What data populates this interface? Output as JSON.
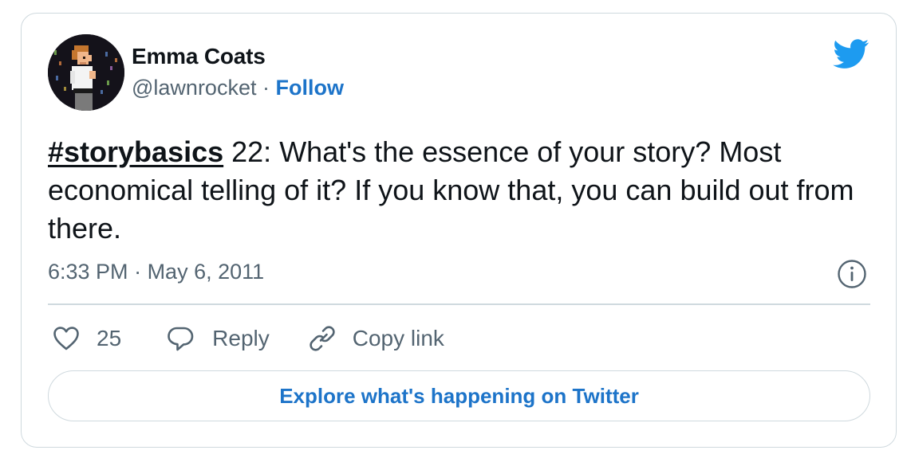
{
  "author": {
    "name": "Emma Coats",
    "handle": "@lawnrocket",
    "separator": " · ",
    "follow_label": "Follow"
  },
  "tweet": {
    "hashtag": "#storybasics",
    "body": " 22: What's the essence of your story? Most economical telling of it? If you know that, you can build out from there."
  },
  "meta": {
    "time": "6:33 PM",
    "separator": " · ",
    "date": "May 6, 2011"
  },
  "actions": {
    "like_count": "25",
    "reply_label": "Reply",
    "copy_label": "Copy link"
  },
  "cta": {
    "label": "Explore what's happening on Twitter"
  },
  "colors": {
    "accent_blue": "#1d74c9",
    "twitter_bird": "#1d9bf0",
    "secondary_text": "#536471",
    "border": "#cfd9de"
  },
  "icons": {
    "logo": "twitter-bird-icon",
    "info": "info-icon",
    "like": "heart-icon",
    "reply": "speech-bubble-icon",
    "copy": "link-icon"
  }
}
